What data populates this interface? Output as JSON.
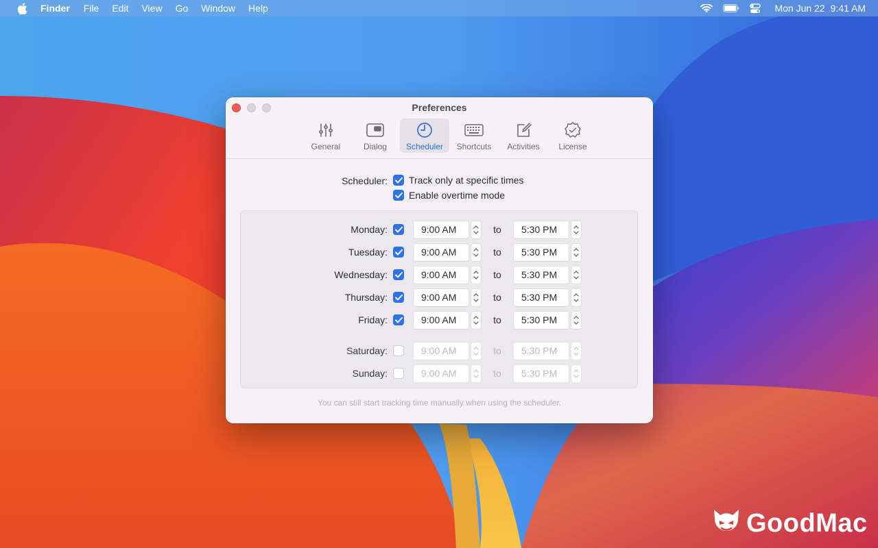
{
  "menubar": {
    "app": "Finder",
    "items": [
      "File",
      "Edit",
      "View",
      "Go",
      "Window",
      "Help"
    ],
    "date": "Mon Jun 22",
    "time": "9:41 AM"
  },
  "window": {
    "title": "Preferences",
    "tabs": [
      {
        "label": "General",
        "icon": "sliders-icon"
      },
      {
        "label": "Dialog",
        "icon": "dialog-icon"
      },
      {
        "label": "Scheduler",
        "icon": "clock-icon",
        "active": true
      },
      {
        "label": "Shortcuts",
        "icon": "keyboard-icon"
      },
      {
        "label": "Activities",
        "icon": "edit-icon"
      },
      {
        "label": "License",
        "icon": "badge-check-icon"
      }
    ],
    "scheduler_label": "Scheduler:",
    "options": [
      {
        "label": "Track only at specific times",
        "checked": true
      },
      {
        "label": "Enable overtime mode",
        "checked": true
      }
    ],
    "to_label": "to",
    "days": [
      {
        "label": "Monday:",
        "checked": true,
        "from": "9:00 AM",
        "to": "5:30 PM"
      },
      {
        "label": "Tuesday:",
        "checked": true,
        "from": "9:00 AM",
        "to": "5:30 PM"
      },
      {
        "label": "Wednesday:",
        "checked": true,
        "from": "9:00 AM",
        "to": "5:30 PM"
      },
      {
        "label": "Thursday:",
        "checked": true,
        "from": "9:00 AM",
        "to": "5:30 PM"
      },
      {
        "label": "Friday:",
        "checked": true,
        "from": "9:00 AM",
        "to": "5:30 PM"
      },
      {
        "label": "Saturday:",
        "checked": false,
        "from": "9:00 AM",
        "to": "5:30 PM"
      },
      {
        "label": "Sunday:",
        "checked": false,
        "from": "9:00 AM",
        "to": "5:30 PM"
      }
    ],
    "footnote": "You can still start tracking time manually when using the scheduler."
  },
  "watermark": {
    "text": "GoodMac"
  },
  "colors": {
    "accent": "#2b73e6",
    "close": "#ee5d57"
  }
}
